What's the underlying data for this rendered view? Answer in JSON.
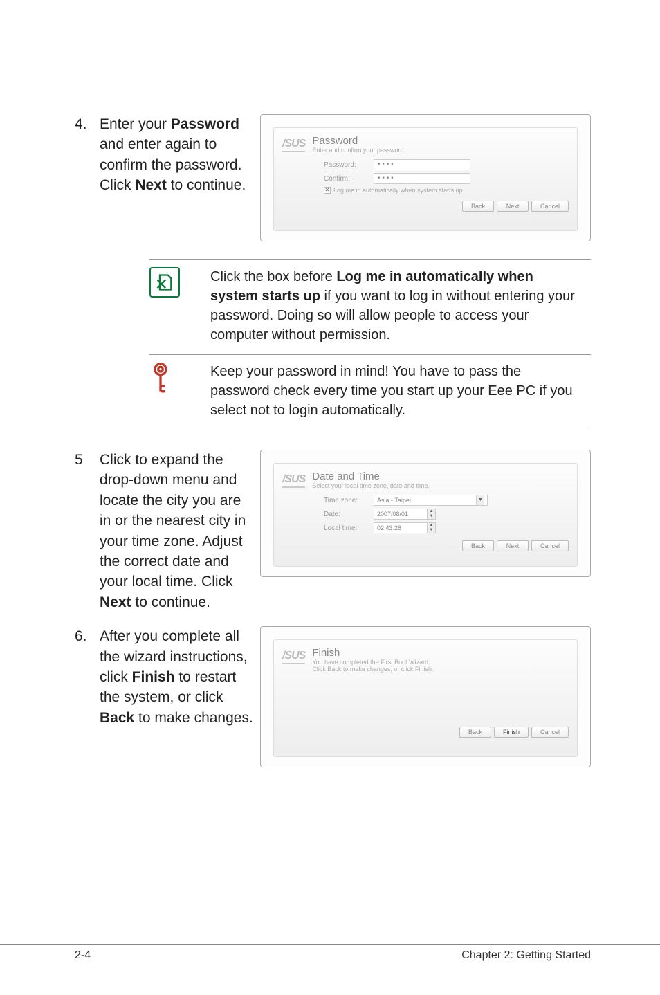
{
  "steps": {
    "s4": {
      "num": "4.",
      "text_parts": [
        "Enter your ",
        "Password",
        " and enter again to confirm the password. Click ",
        "Next",
        " to continue."
      ]
    },
    "s5": {
      "num": "5",
      "text_parts": [
        "Click to expand the drop-down menu and locate the city you are in or the nearest city in your time zone. Adjust the correct date and your local time. Click ",
        "Next",
        " to continue."
      ]
    },
    "s6": {
      "num": "6.",
      "text_parts": [
        "After you complete all the wizard instructions, click ",
        "Finish",
        " to restart the system, or click ",
        "Back",
        " to make changes."
      ]
    }
  },
  "notes": {
    "n1_parts": [
      "Click the box before ",
      "Log me in automatically when system starts up",
      " if you want to log in without entering your password. Doing so will allow people to access your computer without permission."
    ],
    "n2": "Keep your password in mind! You have to pass the password check every time you start up your Eee PC if you select not to login automatically."
  },
  "wizard_password": {
    "logo": "/SUS",
    "title": "Password",
    "sub": "Enter and confirm your password.",
    "label_pw": "Password:",
    "value_pw": "••••",
    "label_cf": "Confirm:",
    "value_cf": "••••",
    "checkbox_label": "Log me in automatically when system starts up",
    "checkbox_checked": "✕",
    "btn_back": "Back",
    "btn_next": "Next",
    "btn_cancel": "Cancel"
  },
  "wizard_datetime": {
    "logo": "/SUS",
    "title": "Date and Time",
    "sub": "Select your local time zone, date and time.",
    "label_tz": "Time zone:",
    "value_tz": "Asia - Taipei",
    "label_date": "Date:",
    "value_date": "2007/08/01",
    "label_time": "Local time:",
    "value_time": "02:43:28",
    "btn_back": "Back",
    "btn_next": "Next",
    "btn_cancel": "Cancel"
  },
  "wizard_finish": {
    "logo": "/SUS",
    "title": "Finish",
    "sub1": "You have completed the First Boot Wizard.",
    "sub2": "Click Back to make changes, or click Finish.",
    "btn_back": "Back",
    "btn_finish": "Finish",
    "btn_cancel": "Cancel"
  },
  "footer": {
    "left": "2-4",
    "right": "Chapter 2: Getting Started"
  }
}
